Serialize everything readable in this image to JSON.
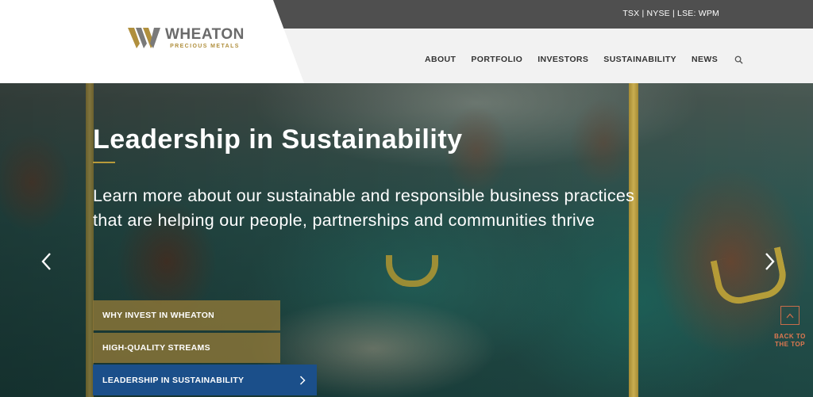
{
  "header": {
    "ticker": "TSX | NYSE | LSE: WPM",
    "logo": {
      "name": "WHEATON",
      "tagline": "PRECIOUS METALS"
    },
    "nav": [
      "ABOUT",
      "PORTFOLIO",
      "INVESTORS",
      "SUSTAINABILITY",
      "NEWS"
    ],
    "search_icon": "search-icon"
  },
  "hero": {
    "title": "Leadership in Sustainability",
    "body": "Learn more about our sustainable and responsible business practices that are helping our people, partnerships and communities thrive",
    "prev_icon": "chevron-left-icon",
    "next_icon": "chevron-right-icon"
  },
  "cta": {
    "items": [
      "WHY INVEST IN WHEATON",
      "HIGH-QUALITY STREAMS",
      "LEADERSHIP IN SUSTAINABILITY"
    ],
    "active_index": 2
  },
  "back_to_top": {
    "line1": "BACK TO",
    "line2": "THE TOP"
  },
  "colors": {
    "topbar": "#4f4f4f",
    "gold": "#b08f3d",
    "active_blue": "#1b4f8a",
    "back_to_top": "#e07850"
  }
}
